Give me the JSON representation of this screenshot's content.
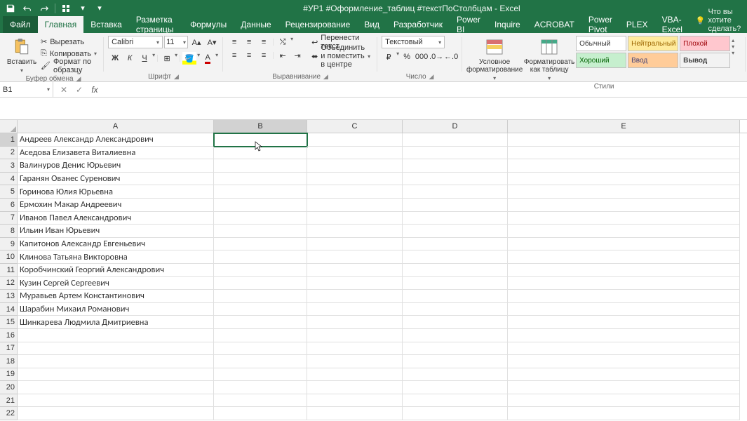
{
  "title": "#УР1 #Оформление_таблиц #текстПоСтолбцам - Excel",
  "tabs": {
    "file": "Файл",
    "home": "Главная",
    "insert": "Вставка",
    "layout": "Разметка страницы",
    "formulas": "Формулы",
    "data": "Данные",
    "review": "Рецензирование",
    "view": "Вид",
    "developer": "Разработчик",
    "powerbi": "Power BI",
    "inquire": "Inquire",
    "acrobat": "ACROBAT",
    "powerpivot": "Power Pivot",
    "plex": "PLEX",
    "vba": "VBA-Excel",
    "tell": "Что вы хотите сделать?"
  },
  "ribbon": {
    "paste": "Вставить",
    "cut": "Вырезать",
    "copy": "Копировать",
    "painter": "Формат по образцу",
    "clipboard_label": "Буфер обмена",
    "font_name": "Calibri",
    "font_size": "11",
    "font_label": "Шрифт",
    "wrap": "Перенести текст",
    "merge": "Объединить и поместить в центре",
    "align_label": "Выравнивание",
    "num_format": "Текстовый",
    "num_label": "Число",
    "cond_fmt": "Условное форматирование",
    "as_table": "Форматировать как таблицу",
    "style_normal": "Обычный",
    "style_neutral": "Нейтральный",
    "style_bad": "Плохой",
    "style_good": "Хороший",
    "style_input": "Ввод",
    "style_output": "Вывод",
    "styles_label": "Стили",
    "insert_btn": "Вст"
  },
  "namebox": "B1",
  "columns": [
    "A",
    "B",
    "C",
    "D",
    "E"
  ],
  "col_classes": [
    "cA",
    "cB",
    "cC",
    "cD",
    "cE"
  ],
  "rows": [
    [
      "Андреев Александр Александрович",
      "",
      "",
      "",
      ""
    ],
    [
      "Аседова Елизавета Виталиевна",
      "",
      "",
      "",
      ""
    ],
    [
      "Валинуров Денис Юрьевич",
      "",
      "",
      "",
      ""
    ],
    [
      "Гаранян Ованес Суренович",
      "",
      "",
      "",
      ""
    ],
    [
      "Горинова Юлия Юрьевна",
      "",
      "",
      "",
      ""
    ],
    [
      "Ермохин Макар Андреевич",
      "",
      "",
      "",
      ""
    ],
    [
      "Иванов Павел Александрович",
      "",
      "",
      "",
      ""
    ],
    [
      "Ильин Иван Юрьевич",
      "",
      "",
      "",
      ""
    ],
    [
      "Капитонов Александр Евгеньевич",
      "",
      "",
      "",
      ""
    ],
    [
      "Клинова Татьяна Викторовна",
      "",
      "",
      "",
      ""
    ],
    [
      "Коробчинский Георгий Александрович",
      "",
      "",
      "",
      ""
    ],
    [
      "Кузин Сергей Сергеевич",
      "",
      "",
      "",
      ""
    ],
    [
      "Муравьев Артем Константинович",
      "",
      "",
      "",
      ""
    ],
    [
      "Шарабин Михаил Романович",
      "",
      "",
      "",
      ""
    ],
    [
      "Шинкарева Людмила Дмитриевна",
      "",
      "",
      "",
      ""
    ],
    [
      "",
      "",
      "",
      "",
      ""
    ],
    [
      "",
      "",
      "",
      "",
      ""
    ],
    [
      "",
      "",
      "",
      "",
      ""
    ],
    [
      "",
      "",
      "",
      "",
      ""
    ],
    [
      "",
      "",
      "",
      "",
      ""
    ],
    [
      "",
      "",
      "",
      "",
      ""
    ],
    [
      "",
      "",
      "",
      "",
      ""
    ]
  ],
  "active_cell": {
    "row": 0,
    "col": 1
  }
}
